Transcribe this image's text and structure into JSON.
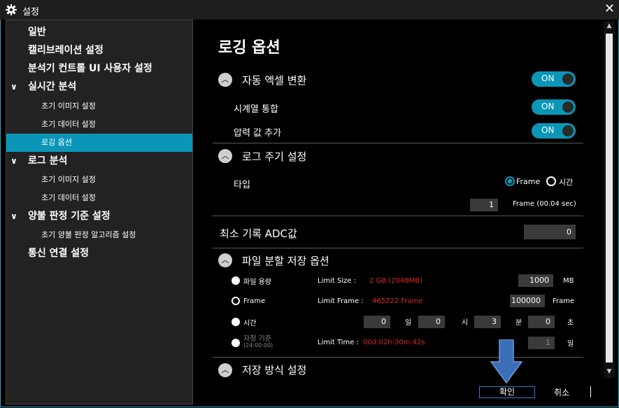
{
  "window": {
    "title": "설정",
    "close_glyph": "✕"
  },
  "sidebar": {
    "items": [
      {
        "label": "일반"
      },
      {
        "label": "캘리브레이션 설정"
      },
      {
        "label": "분석기 컨트롤 UI 사용자 설정"
      },
      {
        "label": "실시간 분석"
      },
      {
        "label": "초기 이미지 설정"
      },
      {
        "label": "초기 데이터 설정"
      },
      {
        "label": "로깅 옵션"
      },
      {
        "label": "로그 분석"
      },
      {
        "label": "초기 이미지 설정"
      },
      {
        "label": "초기 데이터 설정"
      },
      {
        "label": "양불 판정 기준 설정"
      },
      {
        "label": "초기 양불 판정 알고리즘 설정"
      },
      {
        "label": "통신 연결 설정"
      }
    ],
    "selected_index": 6
  },
  "main": {
    "title": "로깅 옵션",
    "sections": {
      "auto_excel": {
        "label": "자동 엑셀 변환",
        "toggle": "ON"
      },
      "timeseries": {
        "label": "시계열 통합",
        "toggle": "ON"
      },
      "pressure": {
        "label": "압력 값 추가",
        "toggle": "ON"
      },
      "log_period": {
        "label": "로그 주기 설정"
      },
      "type": {
        "label": "타입",
        "opt_frame": "Frame",
        "opt_time": "시간",
        "selected": "Frame"
      },
      "frame_value": "1",
      "frame_unit": "Frame  (00.04 sec)",
      "min_adc": {
        "label": "최소 기록 ADC값",
        "value": "0"
      },
      "file_split": {
        "label": "파일 분할 저장 옵션"
      },
      "file_size": {
        "label": "파일 용량",
        "limit_label": "Limit Size :",
        "limit_value": "2 GB (2048MB)",
        "value": "1000",
        "unit": "MB"
      },
      "frame": {
        "label": "Frame",
        "limit_label": "Limit Frame :",
        "limit_value": "465222 Frame",
        "value": "100000",
        "unit": "Frame"
      },
      "time": {
        "label": "시간",
        "day_value": "0",
        "day_unit": "일",
        "hour_value": "0",
        "hour_unit": "시",
        "min_value": "3",
        "min_unit": "분",
        "sec_value": "0",
        "sec_unit": "초"
      },
      "custom": {
        "label": "자정 기준",
        "sub": "(24:00:00)",
        "limit_label": "Limit Time :",
        "limit_value": "00d:02h:30m:42s",
        "value": "1",
        "unit": "일"
      },
      "save_method": {
        "label": "저장 방식 설정"
      }
    }
  },
  "footer": {
    "ok": "확인",
    "cancel": "취소"
  },
  "colors": {
    "accent": "#0b96b8",
    "warning": "#e02828",
    "arrow": "#3a6fb8"
  },
  "icons": {
    "gear": "gear-icon",
    "close": "close-icon",
    "chevron": "chevron-down-icon",
    "collapse": "chevron-up-icon"
  }
}
